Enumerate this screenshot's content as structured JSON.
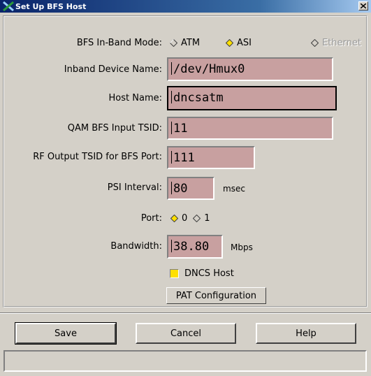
{
  "window": {
    "title": "Set Up BFS Host",
    "close_glyph": "×"
  },
  "form": {
    "mode": {
      "label": "BFS In-Band Mode:",
      "options": [
        {
          "label": "ATM",
          "selected": false,
          "disabled": false
        },
        {
          "label": "ASI",
          "selected": true,
          "disabled": false
        },
        {
          "label": "Ethernet",
          "selected": false,
          "disabled": true
        }
      ]
    },
    "inband_device": {
      "label": "Inband Device Name:",
      "value": "/dev/Hmux0"
    },
    "host_name": {
      "label": "Host Name:",
      "value": "dncsatm"
    },
    "qam_tsid": {
      "label": "QAM BFS Input TSID:",
      "value": "11"
    },
    "rf_tsid": {
      "label": "RF Output TSID for BFS Port:",
      "value": "111"
    },
    "psi": {
      "label": "PSI Interval:",
      "value": "80",
      "unit": "msec"
    },
    "port": {
      "label": "Port:",
      "options": [
        {
          "label": "0",
          "selected": true
        },
        {
          "label": "1",
          "selected": false
        }
      ]
    },
    "bandwidth": {
      "label": "Bandwidth:",
      "value": "38.80",
      "unit": "Mbps"
    },
    "dncs_host": {
      "label": "DNCS Host",
      "checked": true
    },
    "pat_button": "PAT Configuration"
  },
  "actions": {
    "save": "Save",
    "cancel": "Cancel",
    "help": "Help"
  },
  "status_text": "",
  "colors": {
    "field_bg": "#c8a0a0",
    "selected_radio": "#ffe000",
    "window_bg": "#d4d0c8",
    "titlebar": "#0a246a"
  }
}
